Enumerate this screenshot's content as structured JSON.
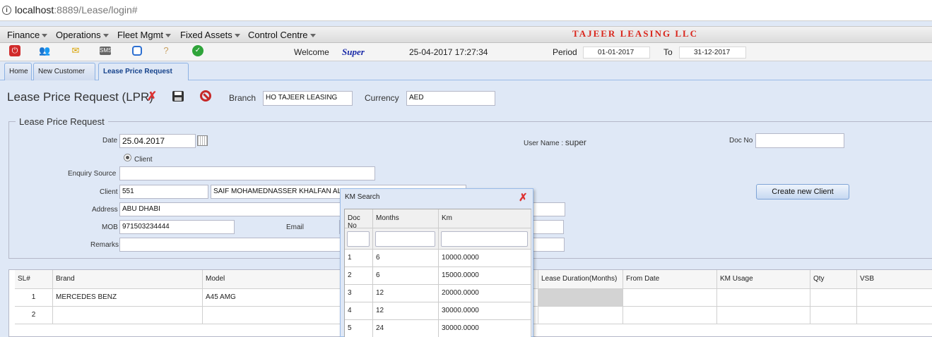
{
  "browser": {
    "host": "localhost",
    "path": ":8889/Lease/login#"
  },
  "menu": [
    "Finance",
    "Operations",
    "Fleet Mgmt",
    "Fixed Assets",
    "Control Centre"
  ],
  "company": "TAJEER LEASING LLC",
  "toolbar": {
    "icons": [
      "power-icon",
      "users-icon",
      "mail-icon",
      "sms-icon",
      "chat-icon",
      "help-icon",
      "check-icon"
    ],
    "welcome_label": "Welcome",
    "user": "Super",
    "datetime": "25-04-2017 17:27:34",
    "period_label": "Period",
    "period_from": "01-01-2017",
    "to_label": "To",
    "period_to": "31-12-2017"
  },
  "tabs": [
    "Home",
    "New Customer",
    "Lease Price Request"
  ],
  "page": {
    "title": "Lease Price Request (LPR)",
    "branch_label": "Branch",
    "branch_value": "HO TAJEER LEASING",
    "currency_label": "Currency",
    "currency_value": "AED"
  },
  "form": {
    "legend": "Lease Price Request",
    "date_label": "Date",
    "date_value": "25.04.2017",
    "user_name_label": "User Name :",
    "user_name_value": "super",
    "doc_no_label": "Doc No",
    "doc_no_value": "",
    "radio_client_label": "Client",
    "enquiry_source_label": "Enquiry Source",
    "enquiry_source_value": "",
    "client_label": "Client",
    "client_code": "551",
    "client_name": "SAIF MOHAMEDNASSER KHALFAN AL",
    "address_label": "Address",
    "address_value": "ABU DHABI",
    "mob_label": "MOB",
    "mob_value": "971503234444",
    "email_label": "Email",
    "remarks_label": "Remarks",
    "create_client_label": "Create new Client"
  },
  "grid": {
    "headers": [
      "SL#",
      "Brand",
      "Model",
      "Lease Duration(Months)",
      "From Date",
      "KM Usage",
      "Qty",
      "VSB"
    ],
    "rows": [
      {
        "sl": "1",
        "brand": "MERCEDES BENZ",
        "model": "A45 AMG"
      },
      {
        "sl": "2",
        "brand": "",
        "model": ""
      }
    ]
  },
  "km_search": {
    "title": "KM Search",
    "headers": [
      "Doc No",
      "Months",
      "Km"
    ],
    "rows": [
      {
        "doc": "1",
        "months": "6",
        "km": "10000.0000"
      },
      {
        "doc": "2",
        "months": "6",
        "km": "15000.0000"
      },
      {
        "doc": "3",
        "months": "12",
        "km": "20000.0000"
      },
      {
        "doc": "4",
        "months": "12",
        "km": "30000.0000"
      },
      {
        "doc": "5",
        "months": "24",
        "km": "30000.0000"
      }
    ]
  }
}
